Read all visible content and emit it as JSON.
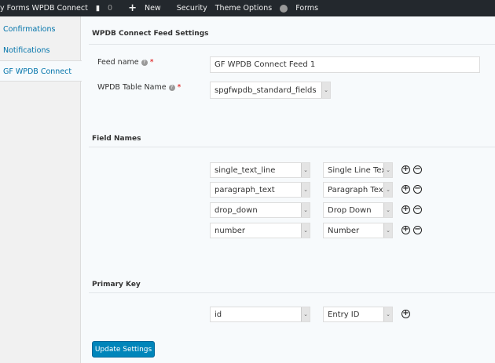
{
  "adminbar": {
    "site": "y Forms WPDB Connect",
    "comments": "0",
    "new": "New",
    "security": "Security",
    "theme_options": "Theme Options",
    "forms": "Forms"
  },
  "sidebar": {
    "items": [
      {
        "label": "Confirmations"
      },
      {
        "label": "Notifications"
      },
      {
        "label": "GF WPDB Connect",
        "active": true
      }
    ]
  },
  "feed_settings": {
    "title": "WPDB Connect Feed Settings",
    "feed_name_label": "Feed name",
    "feed_name_value": "GF WPDB Connect Feed 1",
    "table_label": "WPDB Table Name",
    "table_value": "spgfwpdb_standard_fields",
    "required": "*"
  },
  "field_names": {
    "title": "Field Names",
    "rows": [
      {
        "column": "single_text_line",
        "field": "Single Line Text"
      },
      {
        "column": "paragraph_text",
        "field": "Paragraph Text"
      },
      {
        "column": "drop_down",
        "field": "Drop Down"
      },
      {
        "column": "number",
        "field": "Number"
      }
    ]
  },
  "primary_key": {
    "title": "Primary Key",
    "column": "id",
    "field": "Entry ID"
  },
  "update_label": "Update Settings",
  "colors": {
    "accent": "#0085ba",
    "adminbar": "#23282d",
    "link": "#0073aa"
  }
}
